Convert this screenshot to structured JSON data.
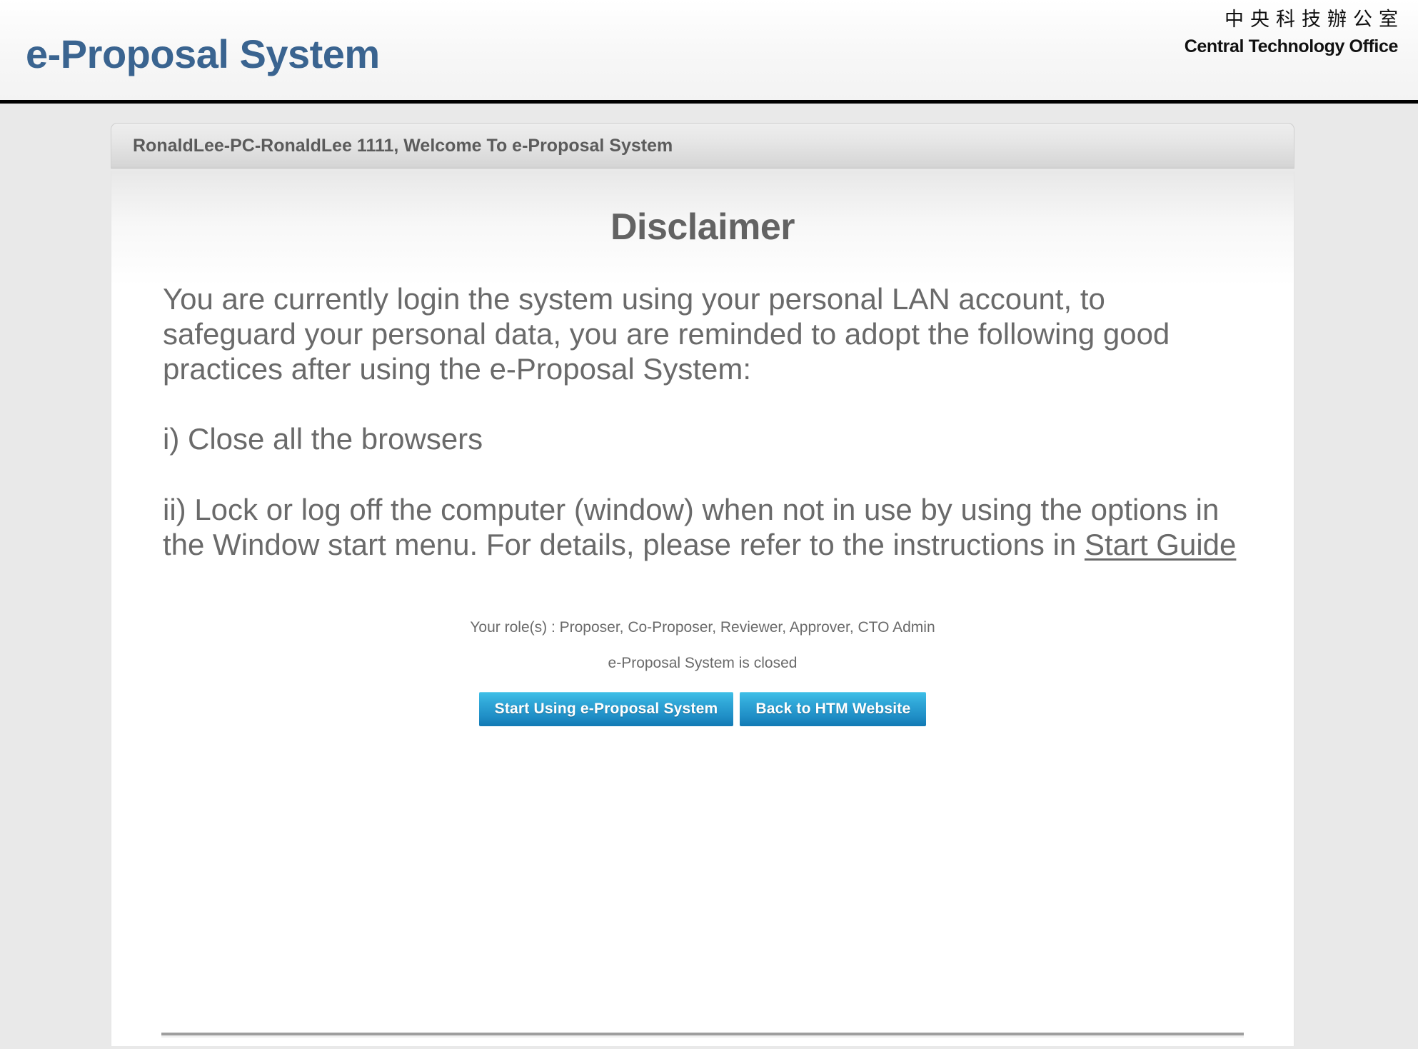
{
  "header": {
    "site_title": "e-Proposal System",
    "org_name_cn": "中央科技辦公室",
    "org_name_en": "Central Technology Office"
  },
  "panel": {
    "welcome_text": "RonaldLee-PC-RonaldLee 1111, Welcome To e-Proposal System"
  },
  "disclaimer": {
    "heading": "Disclaimer",
    "intro": "You are currently login the system using your personal LAN account, to safeguard your personal data, you are reminded to adopt the following good practices after using the e-Proposal System:",
    "item_i": "i) Close all the browsers",
    "item_ii_before_link": "ii) Lock or log off the computer (window) when not in use by using the options in the Window start menu. For details, please refer to the instructions in ",
    "start_guide_link": "Start Guide"
  },
  "status": {
    "roles": "Your role(s) : Proposer, Co-Proposer, Reviewer, Approver, CTO Admin",
    "system_state": "e-Proposal System is closed"
  },
  "actions": {
    "start_button": "Start Using e-Proposal System",
    "back_button": "Back to HTM Website"
  },
  "colors": {
    "brand_blue": "#3a6490",
    "button_blue": "#1f8ec6",
    "body_text_gray": "#6a6a6a",
    "page_background": "#e9e9e9"
  }
}
